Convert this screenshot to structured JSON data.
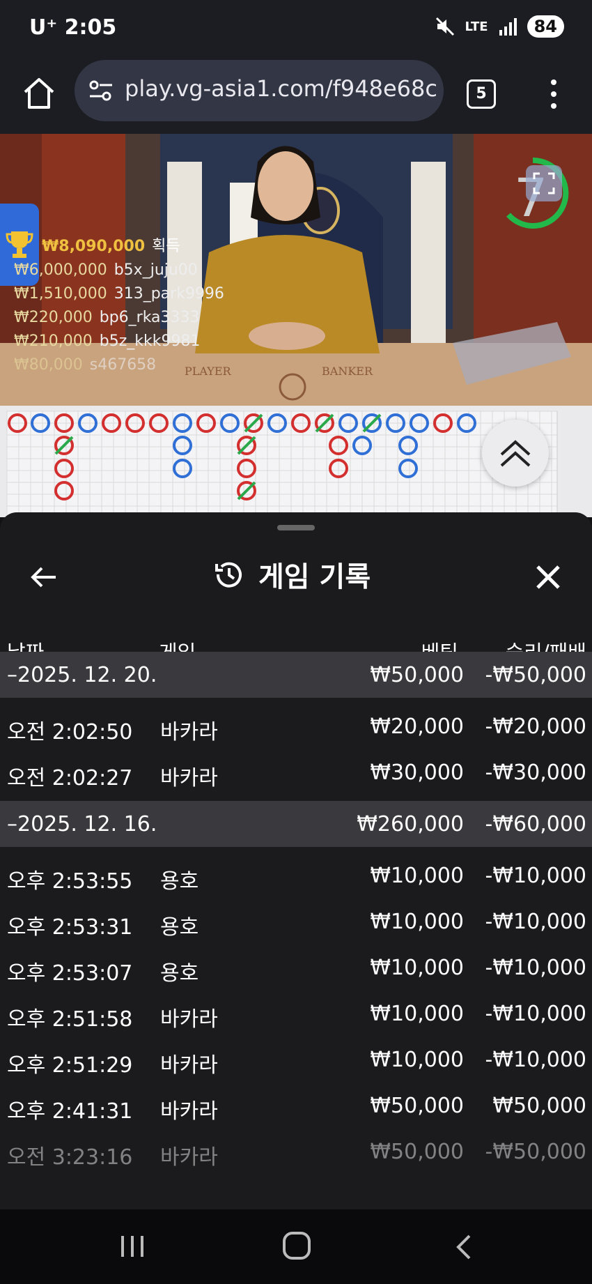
{
  "status_bar": {
    "carrier": "U⁺ 2:05",
    "network": "LTE",
    "battery": "84"
  },
  "browser": {
    "url": "play.vg-asia1.com/f948e68c",
    "tab_count": "5"
  },
  "video": {
    "countdown": "7",
    "table_labels": {
      "player": "PLAYER",
      "banker": "BANKER"
    },
    "winners": [
      {
        "amount": "₩8,090,000",
        "label": "획득"
      },
      {
        "amount": "₩6,000,000",
        "name": "b5x_juju00"
      },
      {
        "amount": "₩1,510,000",
        "name": "313_park9996"
      },
      {
        "amount": "₩220,000",
        "name": "bp6_rka3333"
      },
      {
        "amount": "₩210,000",
        "name": "b5z_kkk9981"
      },
      {
        "amount": "₩80,000",
        "name": "s467658"
      }
    ]
  },
  "sheet": {
    "title": "게임 기록",
    "columns": {
      "date": "날짜",
      "game": "게임",
      "bet": "베팅",
      "winloss": "승리/패배"
    },
    "groups": [
      {
        "date": "–2025. 12. 20.",
        "bet": "₩50,000",
        "winloss": "-₩50,000",
        "rows": [
          {
            "time": "오전 2:02:50",
            "game": "바카라",
            "bet": "₩20,000",
            "winloss": "-₩20,000"
          },
          {
            "time": "오전 2:02:27",
            "game": "바카라",
            "bet": "₩30,000",
            "winloss": "-₩30,000"
          }
        ]
      },
      {
        "date": "–2025. 12. 16.",
        "bet": "₩260,000",
        "winloss": "-₩60,000",
        "rows": [
          {
            "time": "오후 2:53:55",
            "game": "용호",
            "bet": "₩10,000",
            "winloss": "-₩10,000"
          },
          {
            "time": "오후 2:53:31",
            "game": "용호",
            "bet": "₩10,000",
            "winloss": "-₩10,000"
          },
          {
            "time": "오후 2:53:07",
            "game": "용호",
            "bet": "₩10,000",
            "winloss": "-₩10,000"
          },
          {
            "time": "오후 2:51:58",
            "game": "바카라",
            "bet": "₩10,000",
            "winloss": "-₩10,000"
          },
          {
            "time": "오후 2:51:29",
            "game": "바카라",
            "bet": "₩10,000",
            "winloss": "-₩10,000"
          },
          {
            "time": "오후 2:41:31",
            "game": "바카라",
            "bet": "₩50,000",
            "winloss": "₩50,000"
          },
          {
            "time": "오전 3:23:16",
            "game": "바카라",
            "bet": "₩50,000",
            "winloss": "-₩50,000"
          }
        ]
      }
    ]
  },
  "colors": {
    "player": "#2f6fd6",
    "banker": "#d42f2f",
    "tie": "#2aa84a",
    "gold": "#f0c040"
  }
}
